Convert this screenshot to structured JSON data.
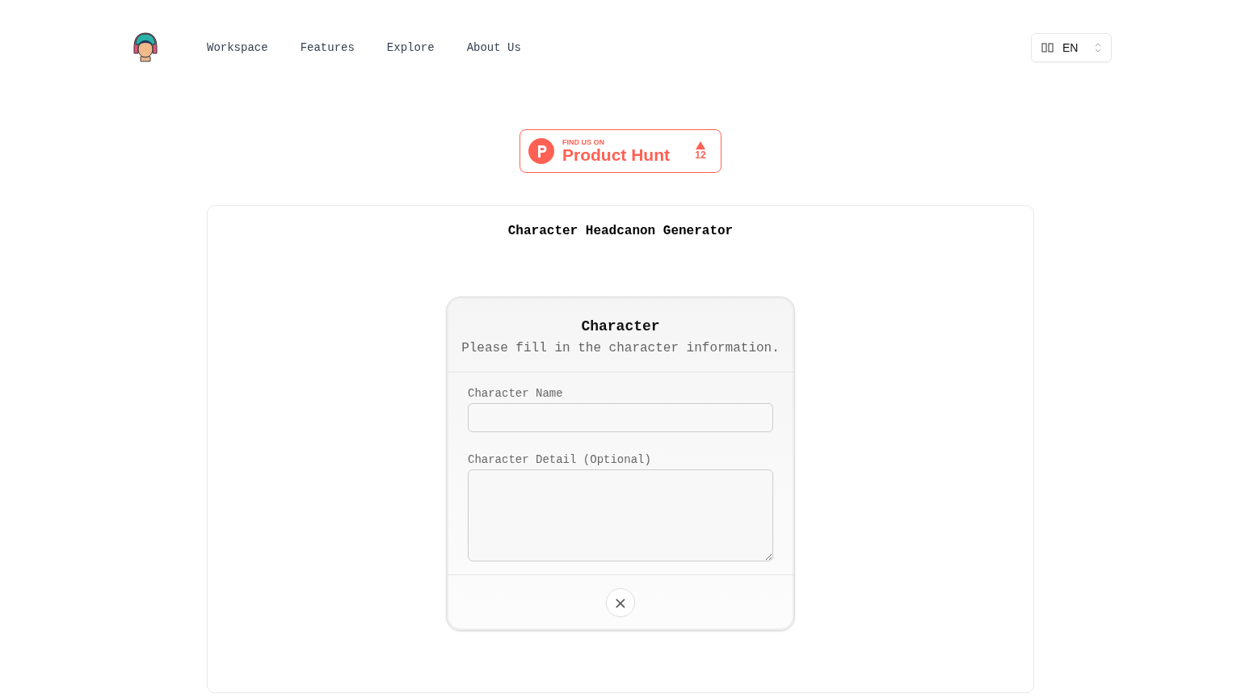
{
  "nav": {
    "links": [
      "Workspace",
      "Features",
      "Explore",
      "About Us"
    ],
    "language": {
      "code": "EN"
    }
  },
  "badge": {
    "kicker": "FIND US ON",
    "name": "Product Hunt",
    "count": "12"
  },
  "main": {
    "title": "Character Headcanon Generator",
    "form": {
      "title": "Character",
      "subtitle": "Please fill in the character information.",
      "fields": [
        {
          "kind": "input",
          "label": "Character Name"
        },
        {
          "kind": "textarea",
          "label": "Character Detail (Optional)"
        }
      ],
      "close_button": "×"
    }
  }
}
